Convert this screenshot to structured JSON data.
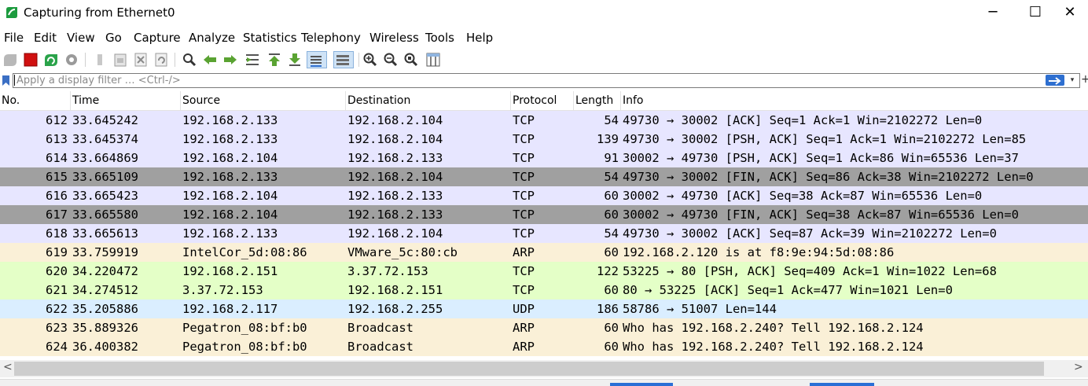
{
  "window": {
    "title": "Capturing from Ethernet0",
    "minimize_glyph": "─",
    "maximize_glyph": "☐",
    "close_glyph": "✕"
  },
  "menu": [
    "File",
    "Edit",
    "View",
    "Go",
    "Capture",
    "Analyze",
    "Statistics",
    "Telephony",
    "Wireless",
    "Tools",
    "Help"
  ],
  "toolbar": {
    "buttons": [
      "start-capture-icon",
      "stop-capture-icon",
      "restart-capture-icon",
      "capture-options-icon",
      "open-file-icon",
      "save-file-icon",
      "close-file-icon",
      "reload-file-icon",
      "find-packet-icon",
      "go-back-icon",
      "go-forward-icon",
      "go-to-packet-icon",
      "go-first-packet-icon",
      "go-last-packet-icon",
      "autoscroll-icon",
      "colorize-icon",
      "zoom-in-icon",
      "zoom-out-icon",
      "normal-size-icon",
      "resize-columns-icon"
    ]
  },
  "filter": {
    "placeholder": "Apply a display filter … <Ctrl-/>"
  },
  "columns": [
    "No.",
    "Time",
    "Source",
    "Destination",
    "Protocol",
    "Length",
    "Info"
  ],
  "colors": {
    "tcp_row": "#e7e6ff",
    "fin_row": "#a0a0a0",
    "arp_row": "#faf0d7",
    "tcp_green_row": "#e4ffc7",
    "udp_row": "#daeeff"
  },
  "packets": [
    {
      "no": "612",
      "time": "33.645242",
      "source": "192.168.2.133",
      "destination": "192.168.2.104",
      "protocol": "TCP",
      "length": "54",
      "info": "49730 → 30002 [ACK] Seq=1 Ack=1 Win=2102272 Len=0",
      "color": "#e7e6ff"
    },
    {
      "no": "613",
      "time": "33.645374",
      "source": "192.168.2.133",
      "destination": "192.168.2.104",
      "protocol": "TCP",
      "length": "139",
      "info": "49730 → 30002 [PSH, ACK] Seq=1 Ack=1 Win=2102272 Len=85",
      "color": "#e7e6ff"
    },
    {
      "no": "614",
      "time": "33.664869",
      "source": "192.168.2.104",
      "destination": "192.168.2.133",
      "protocol": "TCP",
      "length": "91",
      "info": "30002 → 49730 [PSH, ACK] Seq=1 Ack=86 Win=65536 Len=37",
      "color": "#e7e6ff"
    },
    {
      "no": "615",
      "time": "33.665109",
      "source": "192.168.2.133",
      "destination": "192.168.2.104",
      "protocol": "TCP",
      "length": "54",
      "info": "49730 → 30002 [FIN, ACK] Seq=86 Ack=38 Win=2102272 Len=0",
      "color": "#a0a0a0"
    },
    {
      "no": "616",
      "time": "33.665423",
      "source": "192.168.2.104",
      "destination": "192.168.2.133",
      "protocol": "TCP",
      "length": "60",
      "info": "30002 → 49730 [ACK] Seq=38 Ack=87 Win=65536 Len=0",
      "color": "#e7e6ff"
    },
    {
      "no": "617",
      "time": "33.665580",
      "source": "192.168.2.104",
      "destination": "192.168.2.133",
      "protocol": "TCP",
      "length": "60",
      "info": "30002 → 49730 [FIN, ACK] Seq=38 Ack=87 Win=65536 Len=0",
      "color": "#a0a0a0"
    },
    {
      "no": "618",
      "time": "33.665613",
      "source": "192.168.2.133",
      "destination": "192.168.2.104",
      "protocol": "TCP",
      "length": "54",
      "info": "49730 → 30002 [ACK] Seq=87 Ack=39 Win=2102272 Len=0",
      "color": "#e7e6ff"
    },
    {
      "no": "619",
      "time": "33.759919",
      "source": "IntelCor_5d:08:86",
      "destination": "VMware_5c:80:cb",
      "protocol": "ARP",
      "length": "60",
      "info": "192.168.2.120 is at f8:9e:94:5d:08:86",
      "color": "#faf0d7"
    },
    {
      "no": "620",
      "time": "34.220472",
      "source": "192.168.2.151",
      "destination": "3.37.72.153",
      "protocol": "TCP",
      "length": "122",
      "info": "53225 → 80 [PSH, ACK] Seq=409 Ack=1 Win=1022 Len=68",
      "color": "#e4ffc7"
    },
    {
      "no": "621",
      "time": "34.274512",
      "source": "3.37.72.153",
      "destination": "192.168.2.151",
      "protocol": "TCP",
      "length": "60",
      "info": "80 → 53225 [ACK] Seq=1 Ack=477 Win=1021 Len=0",
      "color": "#e4ffc7"
    },
    {
      "no": "622",
      "time": "35.205886",
      "source": "192.168.2.117",
      "destination": "192.168.2.255",
      "protocol": "UDP",
      "length": "186",
      "info": "58786 → 51007 Len=144",
      "color": "#daeeff"
    },
    {
      "no": "623",
      "time": "35.889326",
      "source": "Pegatron_08:bf:b0",
      "destination": "Broadcast",
      "protocol": "ARP",
      "length": "60",
      "info": "Who has 192.168.2.240? Tell 192.168.2.124",
      "color": "#faf0d7"
    },
    {
      "no": "624",
      "time": "36.400382",
      "source": "Pegatron_08:bf:b0",
      "destination": "Broadcast",
      "protocol": "ARP",
      "length": "60",
      "info": "Who has 192.168.2.240? Tell 192.168.2.124",
      "color": "#faf0d7"
    }
  ],
  "scroll": {
    "left_glyph": "<",
    "right_glyph": ">"
  }
}
